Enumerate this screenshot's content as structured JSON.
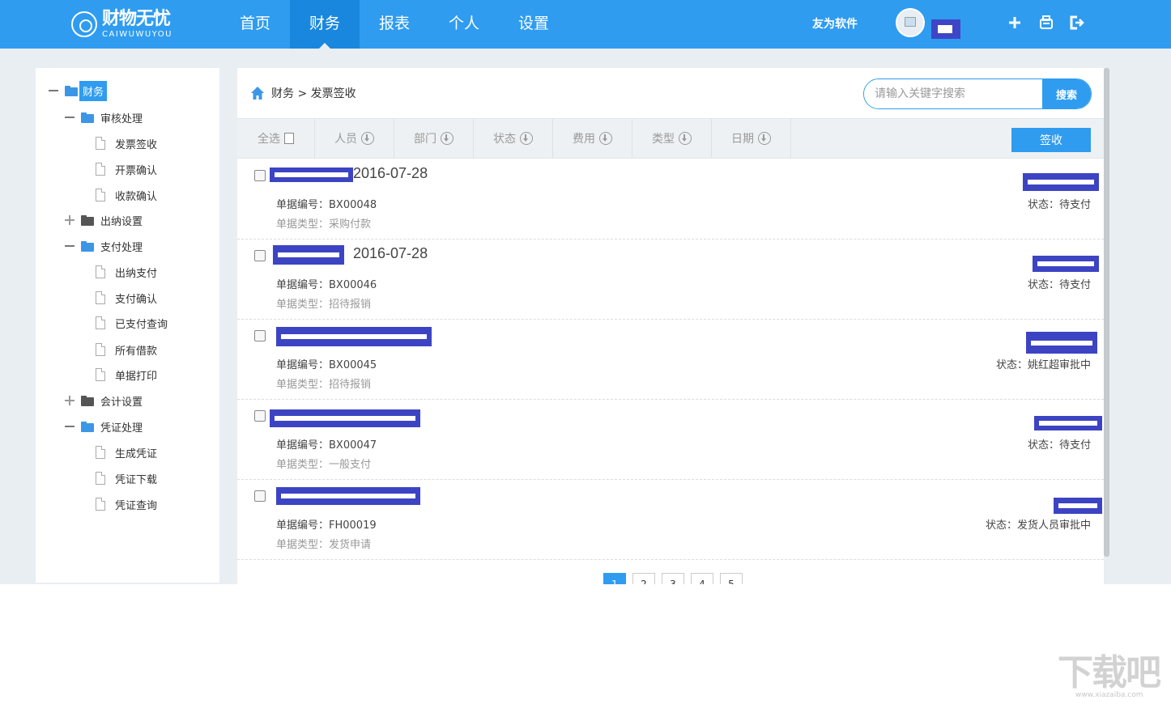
{
  "header": {
    "logo_cn": "财物无忧",
    "logo_en": "CAIWUWUYOU",
    "nav": [
      "首页",
      "财务",
      "报表",
      "个人",
      "设置"
    ],
    "active_nav": "财务",
    "company": "友为软件",
    "icons": [
      "plus-icon",
      "print-icon",
      "logout-icon"
    ]
  },
  "sidebar": {
    "root": "财务",
    "groups": [
      {
        "label": "审核处理",
        "expanded": true,
        "items": [
          "发票签收",
          "开票确认",
          "收款确认"
        ]
      },
      {
        "label": "出纳设置",
        "expanded": false,
        "items": []
      },
      {
        "label": "支付处理",
        "expanded": true,
        "items": [
          "出纳支付",
          "支付确认",
          "已支付查询",
          "所有借款",
          "单据打印"
        ]
      },
      {
        "label": "会计设置",
        "expanded": false,
        "items": []
      },
      {
        "label": "凭证处理",
        "expanded": true,
        "items": [
          "生成凭证",
          "凭证下载",
          "凭证查询"
        ]
      }
    ]
  },
  "main": {
    "breadcrumb": "财务 > 发票签收",
    "search": {
      "placeholder": "请输入关键字搜索",
      "button": "搜索"
    },
    "filters": {
      "select_all": "全选",
      "columns": [
        "人员",
        "部门",
        "状态",
        "费用",
        "类型",
        "日期"
      ],
      "sign_button": "签收"
    },
    "records": [
      {
        "date": "2016-07-28",
        "number": "单据编号：BX00048",
        "type": "单据类型：采购付款",
        "status": "状态：待支付"
      },
      {
        "date": "2016-07-28",
        "number": "单据编号：BX00046",
        "type": "单据类型：招待报销",
        "status": "状态：待支付"
      },
      {
        "date": "",
        "number": "单据编号：BX00045",
        "type": "单据类型：招待报销",
        "status": "状态：姚红超审批中"
      },
      {
        "date": "",
        "number": "单据编号：BX00047",
        "type": "单据类型：一般支付",
        "status": "状态：待支付"
      },
      {
        "date": "",
        "number": "单据编号：FH00019",
        "type": "单据类型：发货申请",
        "status": "状态：发货人员审批中"
      }
    ],
    "pagination": [
      "1",
      "2",
      "3",
      "4",
      "5"
    ]
  },
  "watermark": {
    "text": "下载吧",
    "url": "www.xiazaiba.com"
  },
  "colors": {
    "primary": "#2f9cf0",
    "nav_active": "#1a87de",
    "redaction": "#3c44c3",
    "background": "#e9eef3"
  }
}
